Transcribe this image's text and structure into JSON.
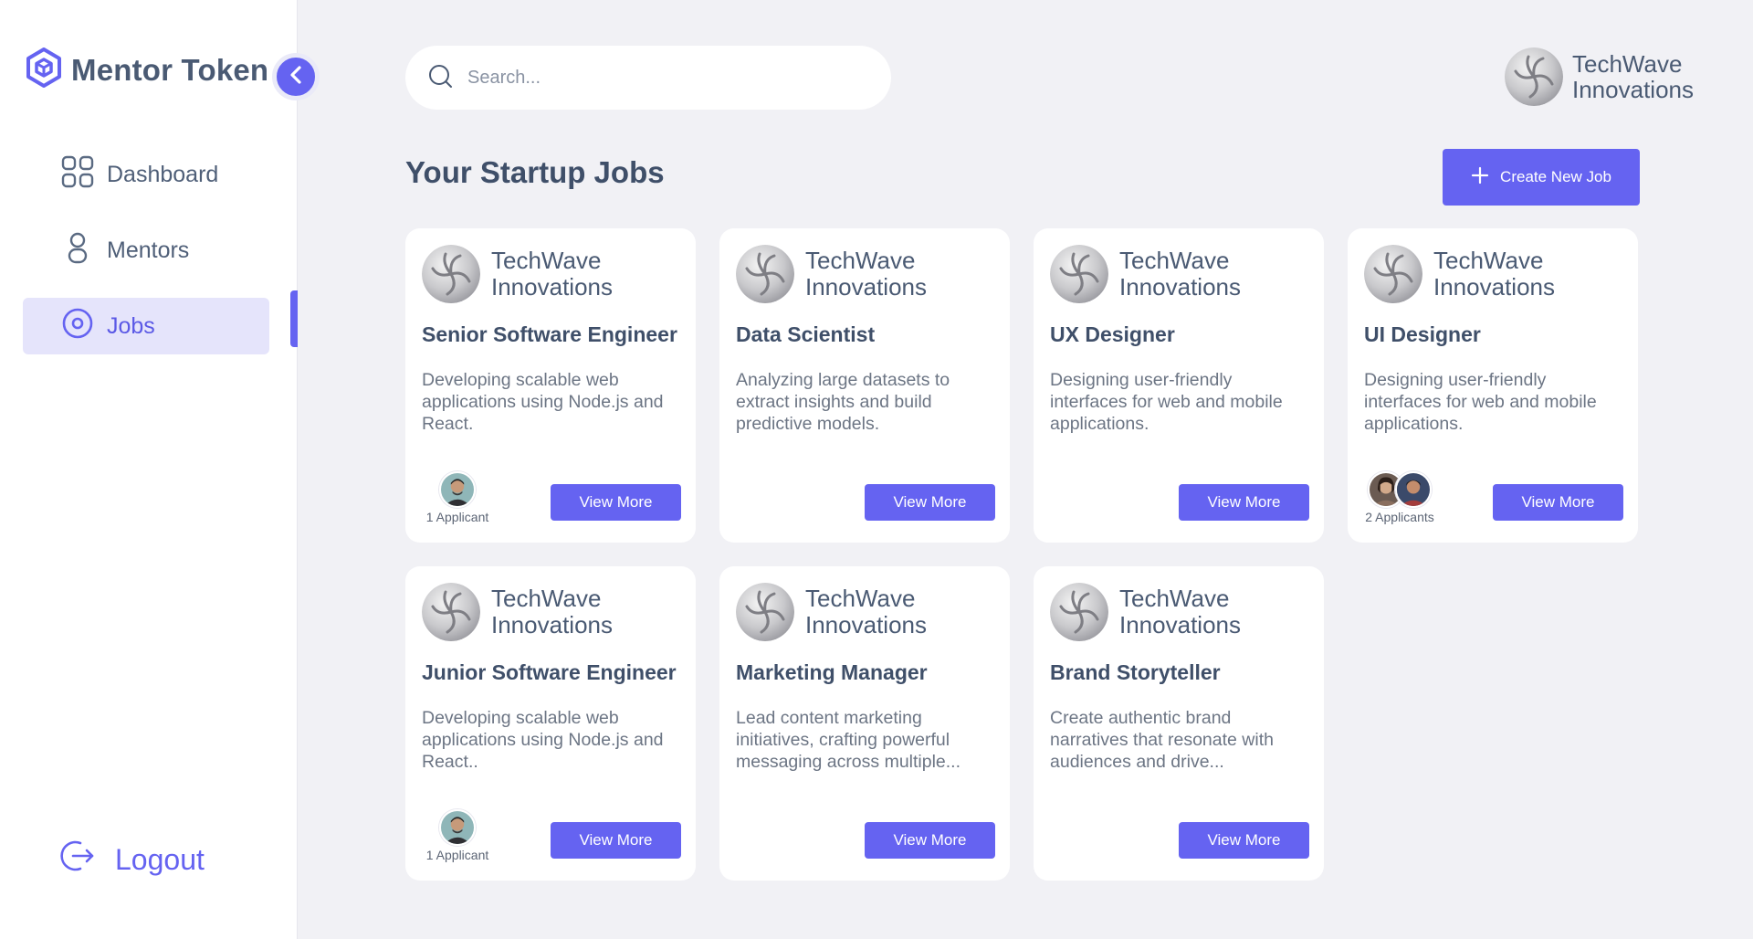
{
  "brand": {
    "name": "Mentor Token"
  },
  "sidebar": {
    "items": [
      {
        "label": "Dashboard",
        "icon": "grid-icon",
        "active": false
      },
      {
        "label": "Mentors",
        "icon": "user-icon",
        "active": false
      },
      {
        "label": "Jobs",
        "icon": "target-icon",
        "active": true
      }
    ],
    "logout_label": "Logout"
  },
  "search": {
    "placeholder": "Search..."
  },
  "profile": {
    "name_line1": "TechWave",
    "name_line2": "Innovations"
  },
  "page": {
    "title": "Your Startup Jobs",
    "create_label": "Create New Job"
  },
  "jobs": [
    {
      "company_line1": "TechWave",
      "company_line2": "Innovations",
      "title": "Senior Software Engineer",
      "description": "Developing scalable web applications using Node.js and React.",
      "applicants_label": "1 Applicant",
      "view_label": "View More"
    },
    {
      "company_line1": "TechWave",
      "company_line2": "Innovations",
      "title": "Data Scientist",
      "description": "Analyzing large datasets to extract insights and build predictive models.",
      "applicants_label": "",
      "view_label": "View More"
    },
    {
      "company_line1": "TechWave",
      "company_line2": "Innovations",
      "title": "UX Designer",
      "description": "Designing user-friendly interfaces for web and mobile applications.",
      "applicants_label": "",
      "view_label": "View More"
    },
    {
      "company_line1": "TechWave",
      "company_line2": "Innovations",
      "title": "UI Designer",
      "description": "Designing user-friendly interfaces for web and mobile applications.",
      "applicants_label": "2 Applicants",
      "view_label": "View More"
    },
    {
      "company_line1": "TechWave",
      "company_line2": "Innovations",
      "title": "Junior Software Engineer",
      "description": "Developing scalable web applications using Node.js and React..",
      "applicants_label": "1 Applicant",
      "view_label": "View More"
    },
    {
      "company_line1": "TechWave",
      "company_line2": "Innovations",
      "title": "Marketing Manager",
      "description": "Lead content marketing initiatives, crafting powerful messaging across multiple...",
      "applicants_label": "",
      "view_label": "View More"
    },
    {
      "company_line1": "TechWave",
      "company_line2": "Innovations",
      "title": "Brand Storyteller",
      "description": "Create authentic brand narratives that resonate with audiences and drive...",
      "applicants_label": "",
      "view_label": "View More"
    }
  ],
  "colors": {
    "accent": "#6563f1",
    "accent_light": "#e5e4fb",
    "background": "#f1f1f5",
    "card": "#ffffff"
  }
}
